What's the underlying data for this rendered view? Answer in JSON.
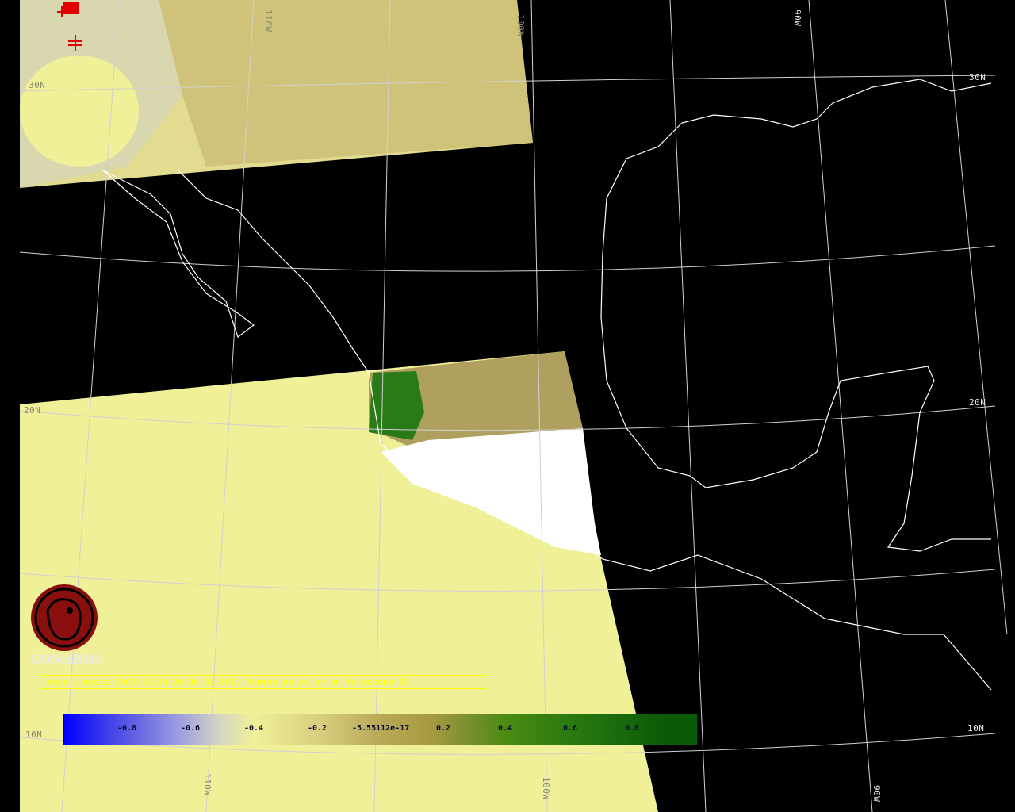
{
  "map": {
    "graticule_labels": {
      "lat_30n_left": "30N",
      "lat_30n_right": "30N",
      "lat_20n_left": "20N",
      "lat_20n_right": "20N",
      "lat_10n_left": "10N",
      "lat_10n_right": "10N",
      "lon_110w_top": "110W",
      "lon_100w_top": "100W",
      "lon_90w_top": "90W",
      "lon_110w_bottom": "110W",
      "lon_100w_bottom": "100W",
      "lon_90w_bottom": "90W"
    },
    "caption": "aqua 1 modis 2007/10/24 20:26:03 EVI. Puntos de calor en la escena 61",
    "logo_text": "CONABIO",
    "colors": {
      "background": "#000000",
      "no_data_fill": "#f0f098",
      "coastline": "#ffffff",
      "graticule": "#d0d0d0",
      "caption": "#ffff00",
      "hotspot": "#e00000",
      "logo": "#8a1010"
    }
  },
  "legend": {
    "ticks": [
      "-0.8",
      "-0.6",
      "-0.4",
      "-0.2",
      "-5.55112e-17",
      "0.2",
      "0.4",
      "0.6",
      "0.8"
    ],
    "range": [
      -1,
      1
    ]
  }
}
